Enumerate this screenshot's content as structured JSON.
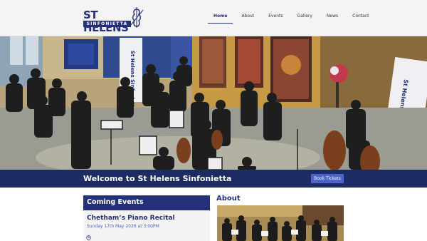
{
  "logo": {
    "line1": "ST HELENS",
    "line2": "SINFONIETTA"
  },
  "nav": {
    "items": [
      {
        "label": "Home",
        "active": true
      },
      {
        "label": "About",
        "active": false
      },
      {
        "label": "Events",
        "active": false
      },
      {
        "label": "Gallery",
        "active": false
      },
      {
        "label": "News",
        "active": false
      },
      {
        "label": "Contact",
        "active": false
      }
    ]
  },
  "hero": {
    "banner_left_text": "St Helens Sinfonietta",
    "banner_right_text": "St Helens Sinfonietta"
  },
  "welcome": {
    "title": "Welcome to St Helens Sinfonietta",
    "button_label": "Book Tickets"
  },
  "events": {
    "heading": "Coming Events",
    "items": [
      {
        "title": "Chetham’s Piano Recital",
        "date": "Sunday 17th May 2026 at 3:00PM"
      }
    ]
  },
  "about": {
    "heading": "About"
  },
  "colors": {
    "brand": "#24317a",
    "band": "#1d2b63",
    "accent": "#4c63c9"
  }
}
